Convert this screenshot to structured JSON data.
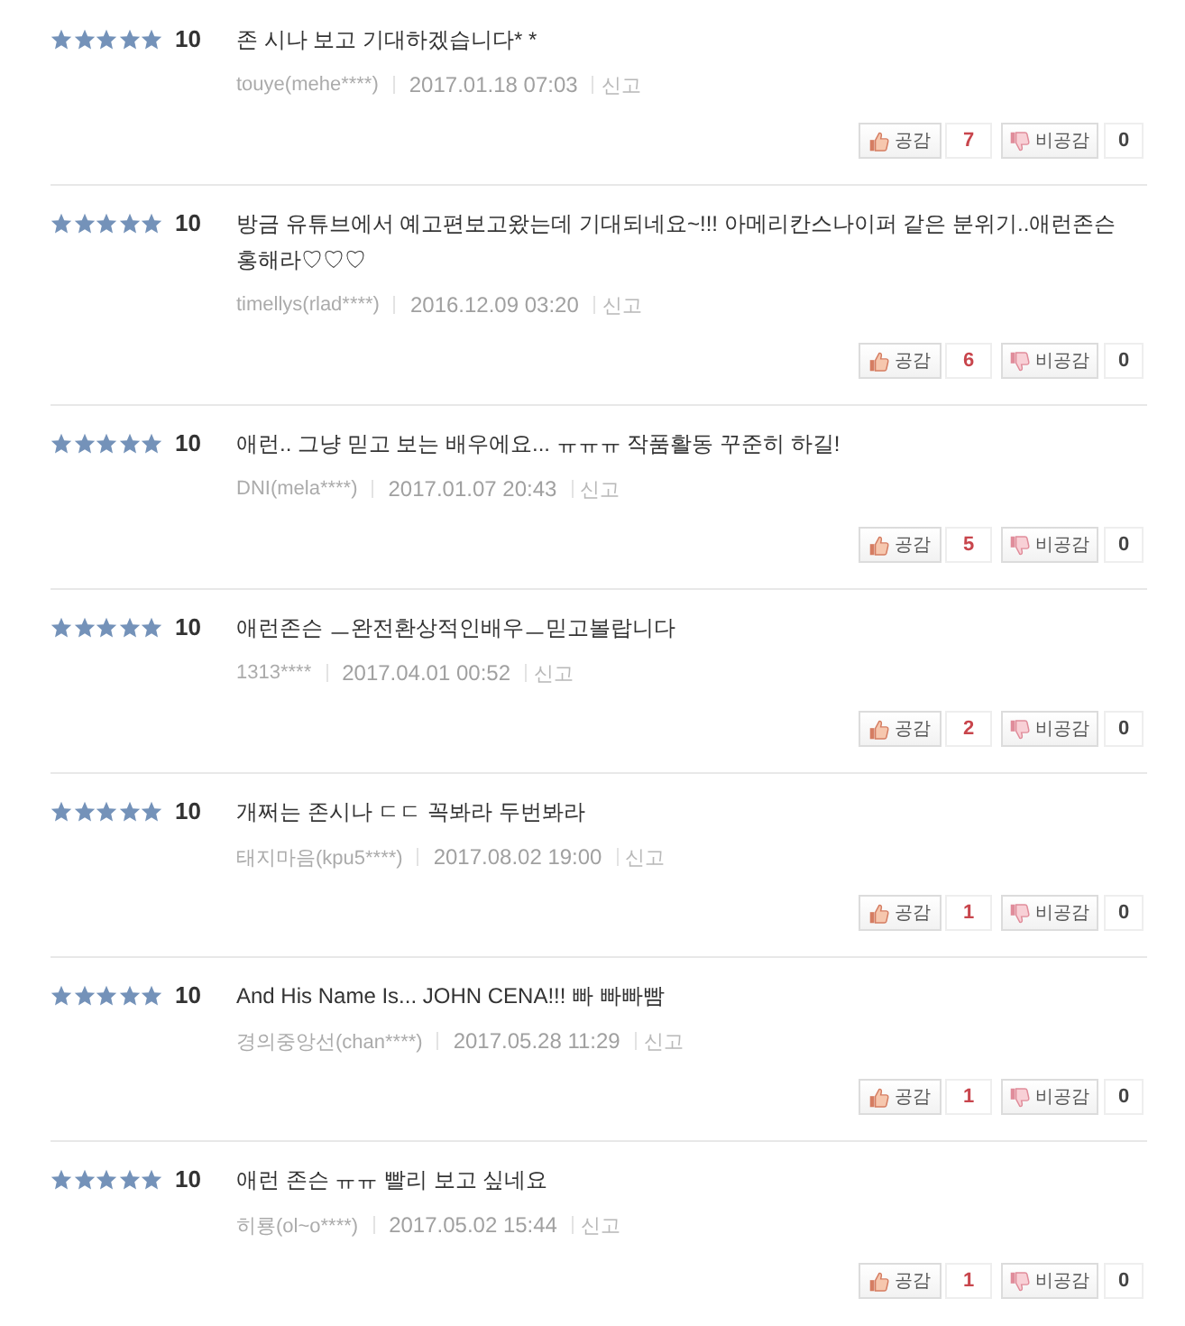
{
  "reviews": [
    {
      "stars": 5,
      "score": "10",
      "text": "존 시나 보고 기대하겠습니다* *",
      "author": "touye(mehe****)",
      "date": "2017.01.18 07:03",
      "report": "신고",
      "like": {
        "label": "공감",
        "count": "7"
      },
      "dislike": {
        "label": "비공감",
        "count": "0"
      }
    },
    {
      "stars": 5,
      "score": "10",
      "text": "방금 유튜브에서 예고편보고왔는데 기대되네요~!!! 아메리칸스나이퍼 같은 분위기..애런존슨 홍해라♡♡♡",
      "author": "timellys(rlad****)",
      "date": "2016.12.09 03:20",
      "report": "신고",
      "like": {
        "label": "공감",
        "count": "6"
      },
      "dislike": {
        "label": "비공감",
        "count": "0"
      }
    },
    {
      "stars": 5,
      "score": "10",
      "text": "애런.. 그냥 믿고 보는 배우에요... ㅠㅠㅠ 작품활동 꾸준히 하길!",
      "author": "DNI(mela****)",
      "date": "2017.01.07 20:43",
      "report": "신고",
      "like": {
        "label": "공감",
        "count": "5"
      },
      "dislike": {
        "label": "비공감",
        "count": "0"
      }
    },
    {
      "stars": 5,
      "score": "10",
      "text": "애런존슨 ㅡ완전환상적인배우ㅡ믿고볼랍니다",
      "author": "1313****",
      "date": "2017.04.01 00:52",
      "report": "신고",
      "like": {
        "label": "공감",
        "count": "2"
      },
      "dislike": {
        "label": "비공감",
        "count": "0"
      }
    },
    {
      "stars": 5,
      "score": "10",
      "text": "개쩌는 존시나 ㄷㄷ 꼭봐라 두번봐라",
      "author": "태지마음(kpu5****)",
      "date": "2017.08.02 19:00",
      "report": "신고",
      "like": {
        "label": "공감",
        "count": "1"
      },
      "dislike": {
        "label": "비공감",
        "count": "0"
      }
    },
    {
      "stars": 5,
      "score": "10",
      "text": "And His Name Is... JOHN CENA!!! 빠 빠빠빰",
      "author": "경의중앙선(chan****)",
      "date": "2017.05.28 11:29",
      "report": "신고",
      "like": {
        "label": "공감",
        "count": "1"
      },
      "dislike": {
        "label": "비공감",
        "count": "0"
      }
    },
    {
      "stars": 5,
      "score": "10",
      "text": "애런 존슨 ㅠㅠ 빨리 보고 싶네요",
      "author": "히룡(ol~o****)",
      "date": "2017.05.02 15:44",
      "report": "신고",
      "like": {
        "label": "공감",
        "count": "1"
      },
      "dislike": {
        "label": "비공감",
        "count": "0"
      }
    }
  ]
}
